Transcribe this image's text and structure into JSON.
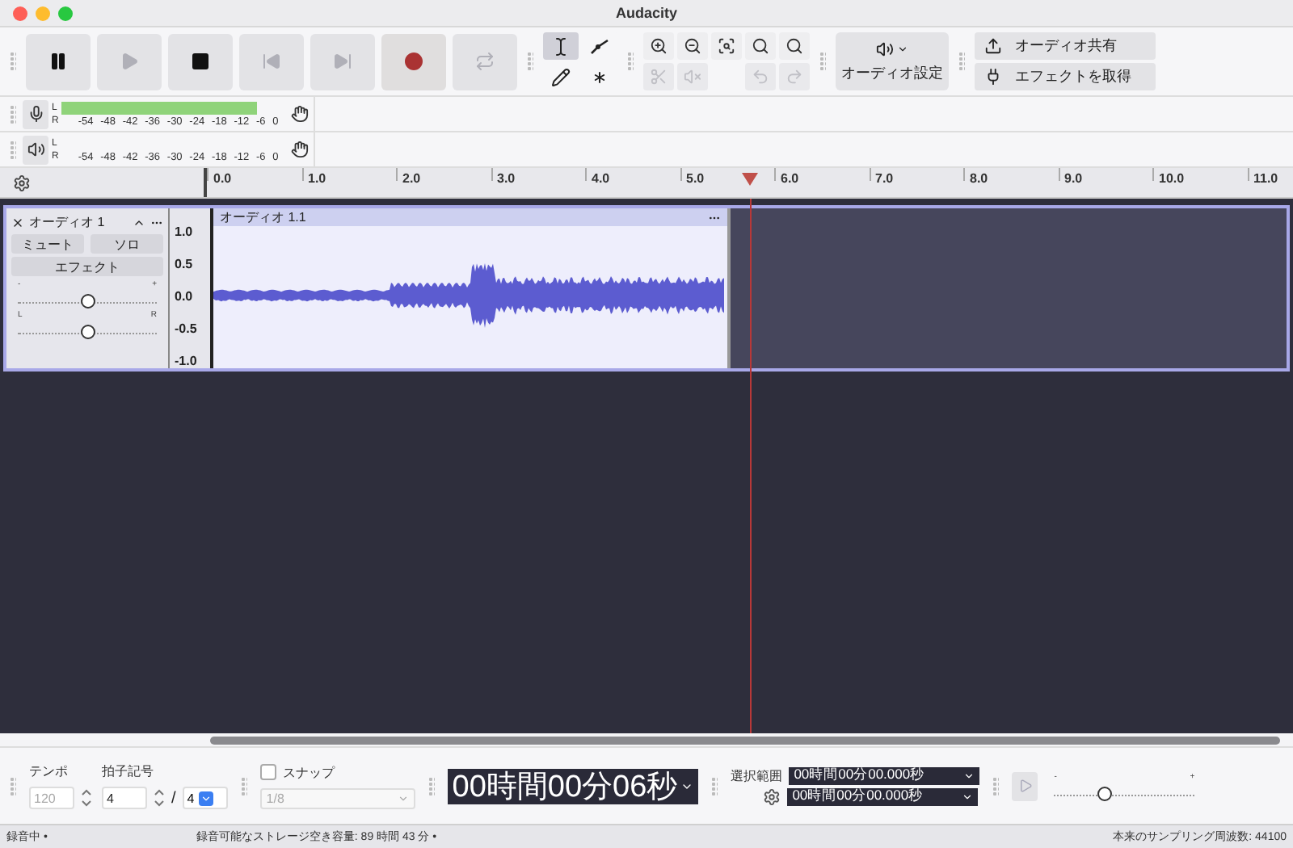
{
  "window": {
    "title": "Audacity"
  },
  "transport": [
    {
      "kind": "pause",
      "disabled": false
    },
    {
      "kind": "play",
      "disabled": true
    },
    {
      "kind": "stop",
      "disabled": false
    },
    {
      "kind": "skip-start",
      "disabled": true
    },
    {
      "kind": "skip-end",
      "disabled": true
    },
    {
      "kind": "record",
      "disabled": false
    },
    {
      "kind": "loop",
      "disabled": true
    }
  ],
  "tools": [
    {
      "kind": "select",
      "selected": true
    },
    {
      "kind": "envelope",
      "selected": false
    },
    {
      "kind": "draw",
      "selected": false
    },
    {
      "kind": "multi",
      "selected": false
    }
  ],
  "zoom_tools": [
    {
      "kind": "zoom-in",
      "disabled": false
    },
    {
      "kind": "zoom-out",
      "disabled": false
    },
    {
      "kind": "fit-selection",
      "disabled": false
    },
    {
      "kind": "fit-project",
      "disabled": false
    },
    {
      "kind": "zoom-toggle",
      "disabled": false
    },
    {
      "kind": "trim",
      "disabled": true
    },
    {
      "kind": "silence",
      "disabled": true
    },
    {
      "kind": "undo",
      "disabled": true
    },
    {
      "kind": "redo",
      "disabled": true
    }
  ],
  "audio_setup": {
    "label": "オーディオ設定"
  },
  "share": [
    {
      "kind": "share",
      "label": "オーディオ共有"
    },
    {
      "kind": "effects",
      "label": "エフェクトを取得"
    }
  ],
  "meters": [
    {
      "kind": "record",
      "left": "L",
      "right": "R",
      "level": 0.86,
      "scale": [
        "-54",
        "-48",
        "-42",
        "-36",
        "-30",
        "-24",
        "-18",
        "-12",
        "-6",
        "0"
      ]
    },
    {
      "kind": "playback",
      "left": "L",
      "right": "R",
      "scale": [
        "-54",
        "-48",
        "-42",
        "-36",
        "-30",
        "-24",
        "-18",
        "-12",
        "-6",
        "0"
      ]
    }
  ],
  "ruler": {
    "ticks": [
      "0.0",
      "1.0",
      "2.0",
      "3.0",
      "4.0",
      "5.0",
      "6.0",
      "7.0",
      "8.0",
      "9.0",
      "10.0",
      "11.0"
    ],
    "playhead": {
      "level": 0.5
    }
  },
  "track": {
    "name": "オーディオ 1",
    "mute": {
      "label": "ミュート",
      "selected": false
    },
    "solo": {
      "label": "ソロ",
      "selected": false
    },
    "effects": "エフェクト",
    "gain": {
      "min": "-",
      "max": "+",
      "level": 0.5
    },
    "pan": {
      "min": "L",
      "max": "R",
      "level": 0.5
    },
    "scale": [
      "1.0",
      "0.5",
      "0.0",
      "-0.5",
      "-1.0"
    ],
    "clip": {
      "name": "オーディオ 1.1"
    }
  },
  "bottom": {
    "tempo": {
      "label": "テンポ",
      "value": "120",
      "disabled": true
    },
    "time_signature": {
      "label": "拍子記号",
      "upper": "4",
      "separator": "/",
      "lower": "4"
    },
    "snap": {
      "label": "スナップ",
      "checked": false,
      "value": "1/8"
    },
    "time": "00時間00分06秒",
    "selection": {
      "label": "選択範囲",
      "start": "00時間00分00.000秒",
      "end": "00時間00分00.000秒"
    },
    "speed": {
      "min": "-",
      "max": "+",
      "level": 0.35
    }
  },
  "status_bar": {
    "left": "録音中 •",
    "middle": "録音可能なストレージ空き容量: 89 時間 43 分 •",
    "right": "本来のサンプリング周波数: 44100"
  }
}
